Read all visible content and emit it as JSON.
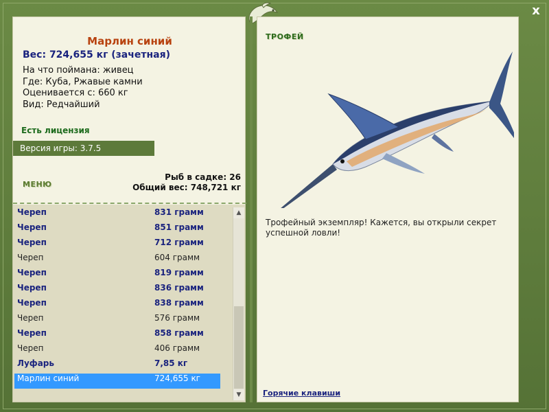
{
  "window": {
    "close_label": "x"
  },
  "fish": {
    "name": "Марлин синий",
    "weight": "Вес: 724,655 кг (зачетная)",
    "caught_on": "На что поймана: живец",
    "where": "Где: Куба, Ржавые камни",
    "valued_from": "Оценивается с: 660 кг",
    "kind": "Вид: Редчайший"
  },
  "license": "Есть лицензия",
  "version": "Версия игры: 3.7.5",
  "menu": {
    "title": "МЕНЮ"
  },
  "stats": {
    "fish_count": "Рыб в садке: 26",
    "total_weight": "Общий вес: 748,721 кг"
  },
  "catch_list": [
    {
      "name": "Череп",
      "weight": "831 грамм",
      "bold": true
    },
    {
      "name": "Череп",
      "weight": "851 грамм",
      "bold": true
    },
    {
      "name": "Череп",
      "weight": "712 грамм",
      "bold": true
    },
    {
      "name": "Череп",
      "weight": "604 грамм",
      "bold": false
    },
    {
      "name": "Череп",
      "weight": "819 грамм",
      "bold": true
    },
    {
      "name": "Череп",
      "weight": "836 грамм",
      "bold": true
    },
    {
      "name": "Череп",
      "weight": "838 грамм",
      "bold": true
    },
    {
      "name": "Череп",
      "weight": "576 грамм",
      "bold": false
    },
    {
      "name": "Череп",
      "weight": "858 грамм",
      "bold": true
    },
    {
      "name": "Череп",
      "weight": "406 грамм",
      "bold": false
    },
    {
      "name": "Луфарь",
      "weight": "7,85 кг",
      "bold": true
    },
    {
      "name": "Марлин синий",
      "weight": "724,655 кг",
      "bold": false,
      "selected": true
    }
  ],
  "trophy": {
    "title": "ТРОФЕЙ",
    "text": "Трофейный экземпляр! Кажется, вы открыли секрет успешной ловли!"
  },
  "hotkeys_label": "Горячие клавиши",
  "colors": {
    "frame": "#5a7a3c",
    "panel": "#f4f3e3",
    "accent_name": "#b84310",
    "bold_text": "#1a237e",
    "selection": "#3399ff"
  },
  "icons": {
    "close": "close-icon",
    "logo": "fish-logo-icon",
    "scroll_up": "scroll-up-icon",
    "scroll_down": "scroll-down-icon"
  }
}
